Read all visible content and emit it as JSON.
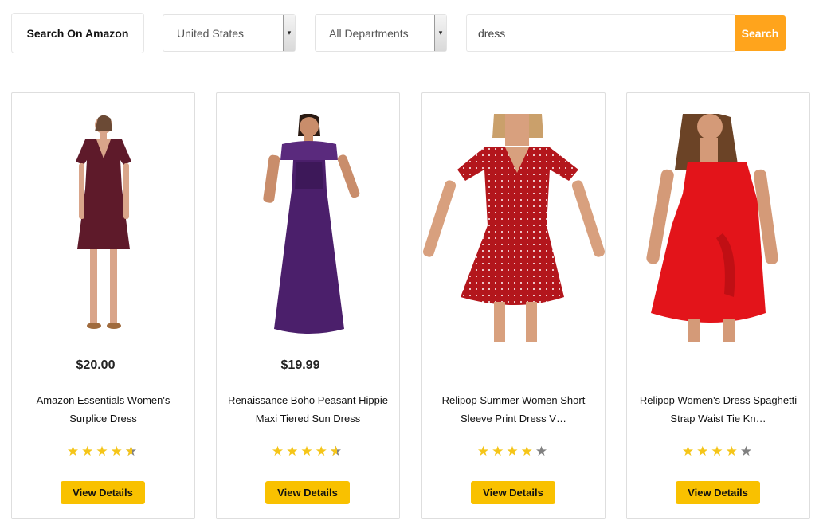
{
  "header": {
    "title": "Search On Amazon",
    "country_select": "United States",
    "department_select": "All Departments",
    "search_value": "dress",
    "search_button": "Search"
  },
  "colors": {
    "search_button": "#ffa41c",
    "details_button": "#f9c100",
    "star_filled": "#f5c518",
    "star_empty": "#808080"
  },
  "products": [
    {
      "price": "$20.00",
      "name": "Amazon Essentials Women's Surplice Dress",
      "rating": 4.5,
      "button": "View Details",
      "dress_color": "#5e1a2a",
      "image_icon": "wrap-dress-image"
    },
    {
      "price": "$19.99",
      "name": "Renaissance Boho Peasant Hippie Maxi Tiered Sun Dress",
      "rating": 4.5,
      "button": "View Details",
      "dress_color": "#4b1f6b",
      "image_icon": "maxi-dress-image"
    },
    {
      "price": "",
      "name": "Relipop Summer Women Short Sleeve Print Dress V…",
      "rating": 4,
      "button": "View Details",
      "dress_color": "#b3161c",
      "image_icon": "print-dress-image"
    },
    {
      "price": "",
      "name": "Relipop Women's Dress Spaghetti Strap Waist Tie Kn…",
      "rating": 4,
      "button": "View Details",
      "dress_color": "#e3141a",
      "image_icon": "strap-dress-image"
    }
  ]
}
